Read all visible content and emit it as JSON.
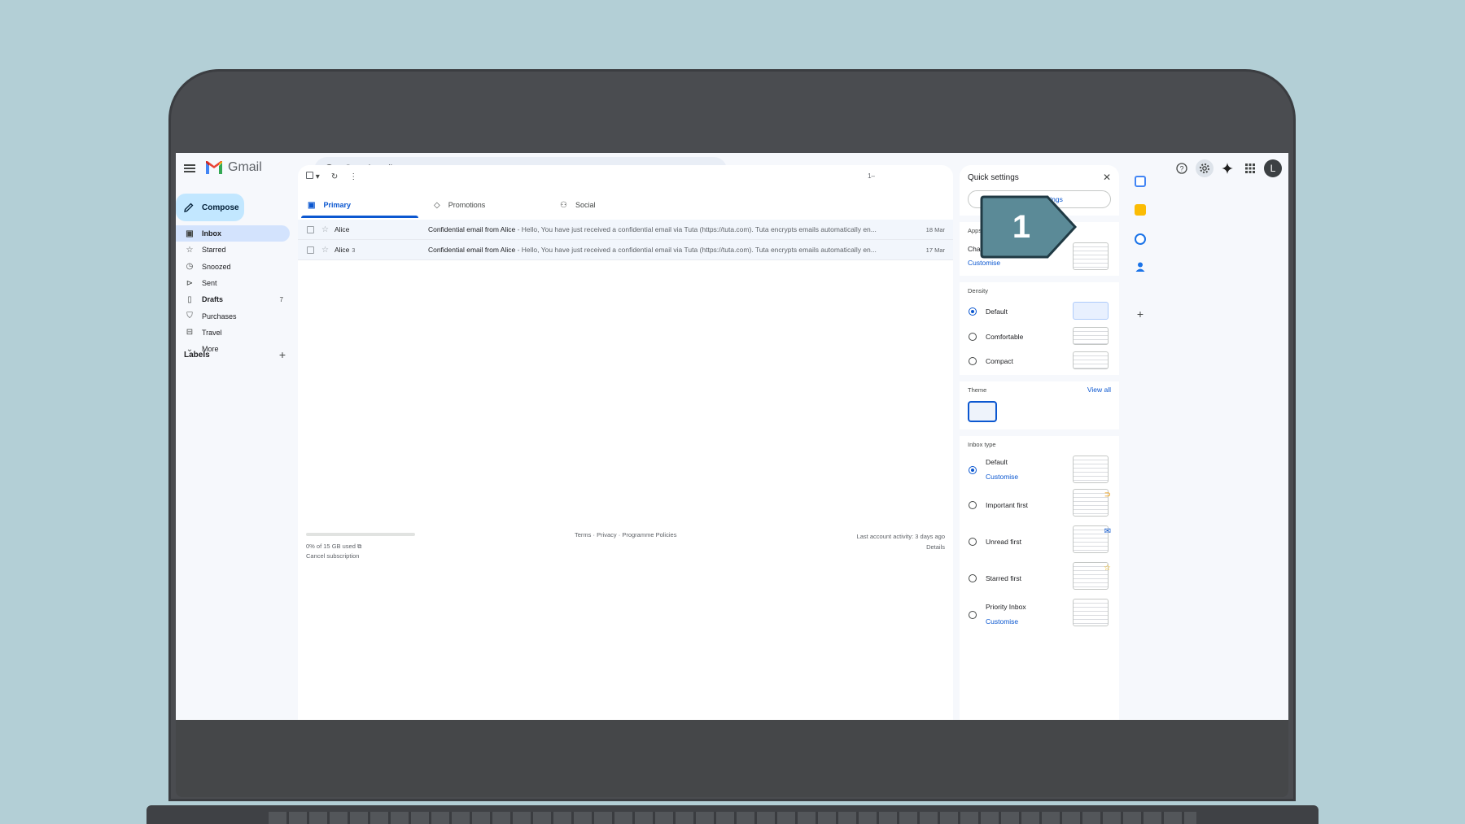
{
  "header": {
    "app_name": "Gmail",
    "search_placeholder": "Search mail",
    "avatar_initial": "L"
  },
  "sidebar": {
    "compose_label": "Compose",
    "items": [
      {
        "label": "Inbox",
        "icon": "inbox-icon",
        "count": "",
        "active": true
      },
      {
        "label": "Starred",
        "icon": "star-icon",
        "count": ""
      },
      {
        "label": "Snoozed",
        "icon": "clock-icon",
        "count": ""
      },
      {
        "label": "Sent",
        "icon": "send-icon",
        "count": ""
      },
      {
        "label": "Drafts",
        "icon": "draft-icon",
        "count": "7"
      },
      {
        "label": "Purchases",
        "icon": "bag-icon",
        "count": ""
      },
      {
        "label": "Travel",
        "icon": "luggage-icon",
        "count": ""
      },
      {
        "label": "More",
        "icon": "chevron-down-icon",
        "count": ""
      }
    ],
    "labels_heading": "Labels"
  },
  "main": {
    "pager": "1–",
    "tabs": [
      {
        "label": "Primary",
        "icon": "inbox-icon"
      },
      {
        "label": "Promotions",
        "icon": "tag-icon"
      },
      {
        "label": "Social",
        "icon": "people-icon"
      }
    ],
    "rows": [
      {
        "sender": "Alice",
        "count": "",
        "subject": "Confidential email from Alice",
        "snippet": " - Hello, You have just received a confidential email via Tuta (https://tuta.com). Tuta encrypts emails automatically en...",
        "date": "18 Mar"
      },
      {
        "sender": "Alice",
        "count": "3",
        "subject": "Confidential email from Alice",
        "snippet": " - Hello, You have just received a confidential email via Tuta (https://tuta.com). Tuta encrypts emails automatically en...",
        "date": "17 Mar"
      }
    ],
    "footer": {
      "storage": "0% of 15 GB used",
      "cancel": "Cancel subscription",
      "links": "Terms · Privacy · Programme Policies",
      "activity": "Last account activity: 3 days ago",
      "details": "Details"
    }
  },
  "quick_settings": {
    "title": "Quick settings",
    "see_all": "See all settings",
    "apps_heading": "Apps in Gmail",
    "chat_meet": "Chat and Meet",
    "customise": "Customise",
    "density_heading": "Density",
    "density": [
      "Default",
      "Comfortable",
      "Compact"
    ],
    "theme_heading": "Theme",
    "view_all": "View all",
    "inbox_heading": "Inbox type",
    "inbox_types": [
      "Default",
      "Important first",
      "Unread first",
      "Starred first",
      "Priority Inbox"
    ]
  },
  "callout": {
    "number": "1",
    "color": "#5b8a97"
  }
}
